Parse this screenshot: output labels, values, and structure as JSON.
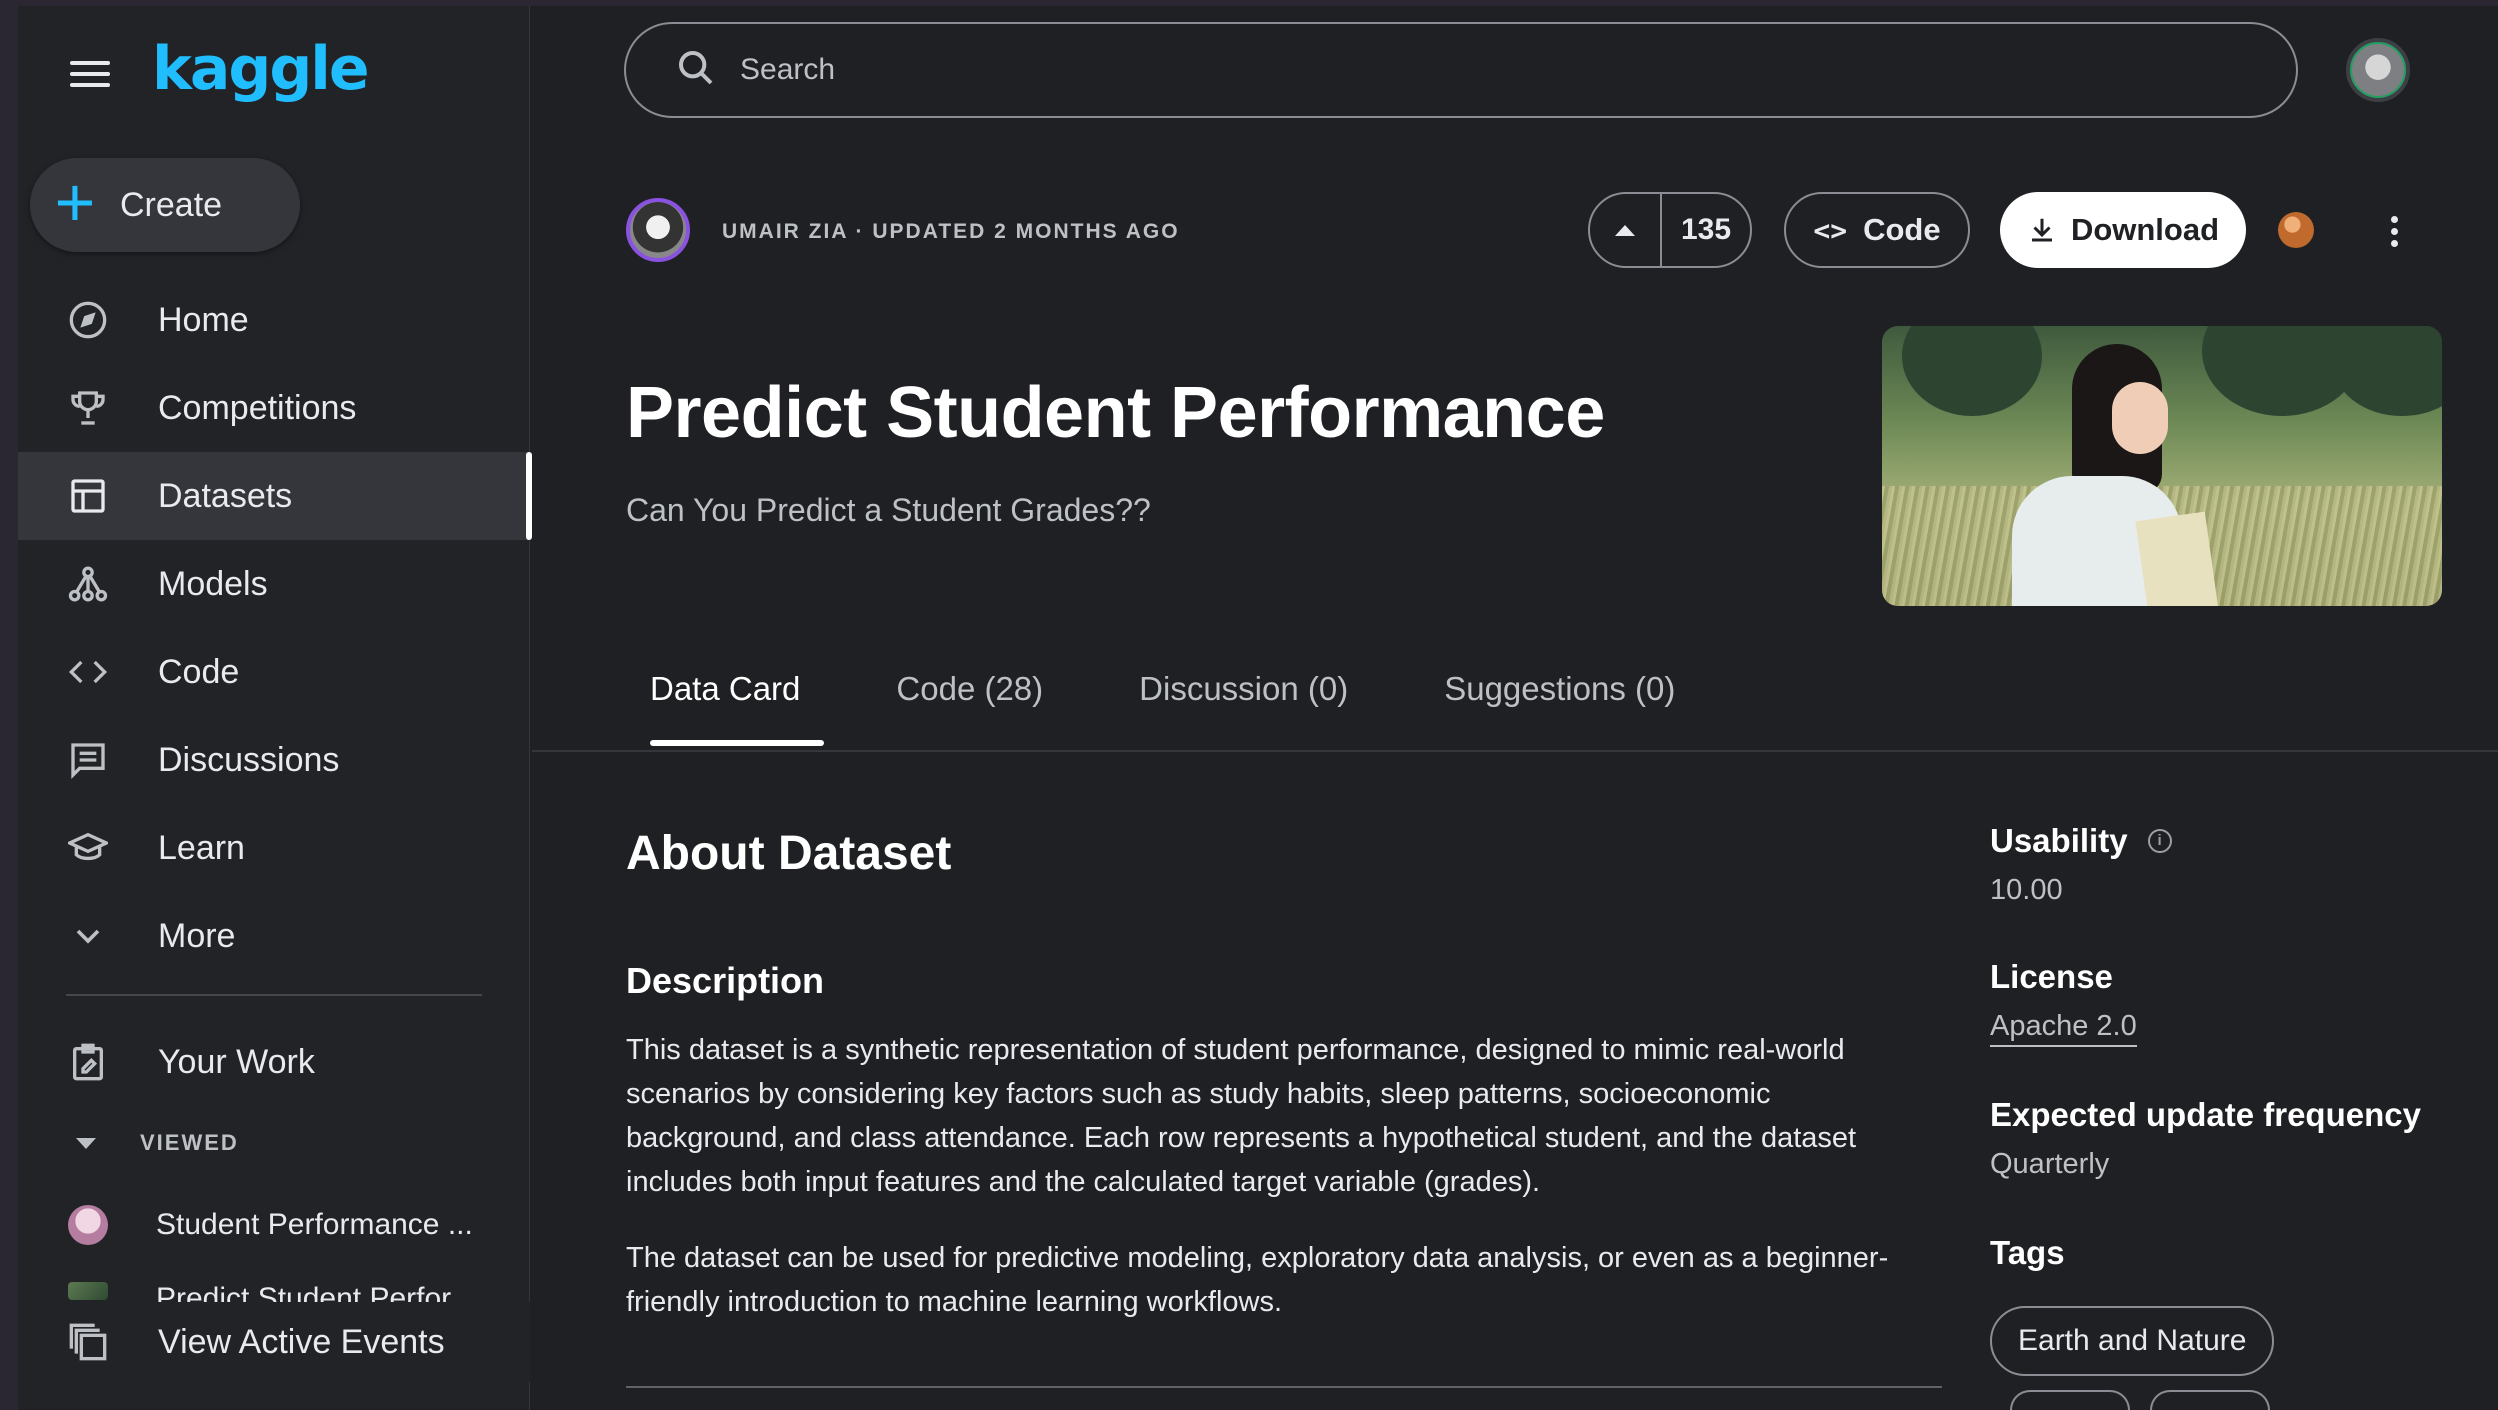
{
  "app": {
    "logo": "kaggle"
  },
  "sidebar": {
    "create_label": "Create",
    "items": [
      {
        "label": "Home",
        "icon": "compass-icon"
      },
      {
        "label": "Competitions",
        "icon": "trophy-icon"
      },
      {
        "label": "Datasets",
        "icon": "table-icon"
      },
      {
        "label": "Models",
        "icon": "models-icon"
      },
      {
        "label": "Code",
        "icon": "code-icon"
      },
      {
        "label": "Discussions",
        "icon": "discussion-icon"
      },
      {
        "label": "Learn",
        "icon": "learn-icon"
      },
      {
        "label": "More",
        "icon": "chevron-down-icon"
      }
    ],
    "your_work": "Your Work",
    "viewed_header": "VIEWED",
    "viewed_items": [
      {
        "label": "Student Performance ..."
      },
      {
        "label": "Predict Student Perfor..."
      }
    ],
    "active_events": "View Active Events"
  },
  "search": {
    "placeholder": "Search"
  },
  "dataset": {
    "author_meta": "UMAIR ZIA · UPDATED 2 MONTHS AGO",
    "votes": "135",
    "code_label": "Code",
    "download_label": "Download",
    "title": "Predict Student Performance",
    "subtitle": "Can You Predict a Student Grades??"
  },
  "tabs": [
    {
      "label": "Data Card"
    },
    {
      "label": "Code (28)"
    },
    {
      "label": "Discussion (0)"
    },
    {
      "label": "Suggestions (0)"
    }
  ],
  "about": {
    "heading": "About Dataset",
    "description_heading": "Description",
    "paragraph1": "This dataset is a synthetic representation of student performance, designed to mimic real-world scenarios by considering key factors such as study habits, sleep patterns, socioeconomic background, and class attendance. Each row represents a hypothetical student, and the dataset includes both input features and the calculated target variable (grades).",
    "paragraph2": "The dataset can be used for predictive modeling, exploratory data analysis, or even as a beginner-friendly introduction to machine learning workflows."
  },
  "info": {
    "usability_label": "Usability",
    "usability_value": "10.00",
    "license_label": "License",
    "license_value": "Apache 2.0",
    "frequency_label": "Expected update frequency",
    "frequency_value": "Quarterly",
    "tags_label": "Tags",
    "tags": [
      "Earth and Nature"
    ]
  },
  "colors": {
    "accent": "#20beff",
    "background": "#1f2023",
    "sidebar": "#222327"
  }
}
